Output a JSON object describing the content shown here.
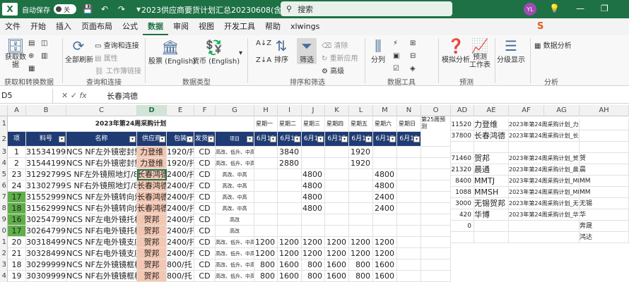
{
  "titlebar": {
    "autosave": "自动保存",
    "toggle": "关",
    "doc_title": "2023供应商要货计划汇总20230608(含...",
    "search_placeholder": "搜索",
    "avatar": "YL"
  },
  "menu": [
    "文件",
    "开始",
    "插入",
    "页面布局",
    "公式",
    "数据",
    "审阅",
    "视图",
    "开发工具",
    "帮助",
    "xlwings"
  ],
  "menu_active": "数据",
  "ribbon": {
    "get_data": "获取数\n据",
    "refresh_all": "全部刷新",
    "query_conn": "查询和连接",
    "properties": "属性",
    "workbook_links": "工作簿链接",
    "stocks": "股票 (English)",
    "currency": "货币 (English)",
    "sort": "排序",
    "filter": "筛选",
    "clear": "清除",
    "reapply": "重新应用",
    "advanced": "高级",
    "split": "分列",
    "whatif": "模拟分析",
    "forecast": "预测\n工作表",
    "outline": "分级显示",
    "data_analysis": "数据分析",
    "groups": {
      "get_transform": "获取和转换数据",
      "query": "查询和连接",
      "data_types": "数据类型",
      "sort_filter": "排序和筛选",
      "data_tools": "数据工具",
      "forecast": "预测",
      "analysis": "分析"
    }
  },
  "formula": {
    "namebox": "D5",
    "value": "长春鸿德"
  },
  "columns": [
    "A",
    "B",
    "C",
    "D",
    "E",
    "F",
    "G",
    "H",
    "I",
    "J",
    "K",
    "L",
    "M",
    "N",
    "O",
    "AD",
    "AE",
    "AF",
    "AG",
    "AH"
  ],
  "selected_column": "D",
  "sheet": {
    "title": "2023年第24周采购计划",
    "day_headers": [
      "星期一",
      "星期二",
      "星期三",
      "星期四",
      "星期五",
      "星期六",
      "星期日"
    ],
    "w25": "第25周预\n测",
    "hdr": [
      "项",
      "料号",
      "名称",
      "供应商",
      "包装",
      "发货地",
      "项目",
      "6月12",
      "6月13",
      "6月14",
      "6月15",
      "6月16",
      "6月17",
      "6月18"
    ],
    "rows": [
      {
        "r": "3",
        "a": "1",
        "b": "315341999",
        "c": "NCS NF左外镜密封垫",
        "d": "力登维",
        "e": "1920/托",
        "f": "CD",
        "g": "高改、低升、中高",
        "vals": [
          "",
          "3840",
          "",
          "",
          "1920",
          "",
          ""
        ],
        "ad": "",
        "ae": "",
        "af": "",
        "ag": "",
        "ah": "",
        "green": false
      },
      {
        "r": "4",
        "a": "2",
        "b": "315441999",
        "c": "NCS NF右外镜密封垫",
        "d": "力登维",
        "e": "1920/托",
        "f": "CD",
        "g": "高改、低升、中高",
        "vals": [
          "",
          "2880",
          "",
          "",
          "1920",
          "",
          ""
        ],
        "ad": "",
        "ae": "",
        "af": "",
        "ag": "",
        "ah": "",
        "green": false
      },
      {
        "r": "5",
        "a": "23",
        "b": "312927999",
        "c": "S NF左外镜照地灯/8202",
        "d": "长春鸿德",
        "e": "2400/托",
        "f": "CD",
        "g": "高改、中高",
        "vals": [
          "",
          "",
          "4800",
          "",
          "",
          "4800",
          ""
        ],
        "ad": "",
        "ae": "",
        "af": "",
        "ag": "",
        "ah": "",
        "green": false
      },
      {
        "r": "6",
        "a": "24",
        "b": "313027999",
        "c": "S NF右外镜照地灯/8202",
        "d": "长春鸿德",
        "e": "2400/托",
        "f": "CD",
        "g": "高改、中高",
        "vals": [
          "",
          "",
          "4800",
          "",
          "",
          "4800",
          ""
        ],
        "ad": "",
        "ae": "",
        "af": "",
        "ag": "",
        "ah": "",
        "green": false
      },
      {
        "r": "7",
        "a": "17",
        "b": "315529999",
        "c": "NCS NF左外镜转向灯",
        "d": "长春鸿德",
        "e": "2400/托",
        "f": "CD",
        "g": "高改、中高",
        "vals": [
          "",
          "",
          "4800",
          "",
          "",
          "2400",
          ""
        ],
        "ad": "",
        "ae": "",
        "af": "",
        "ag": "",
        "ah": "",
        "green": true
      },
      {
        "r": "8",
        "a": "18",
        "b": "315629999",
        "c": "NCS NF右外镜转向灯",
        "d": "长春鸿德",
        "e": "2400/托",
        "f": "CD",
        "g": "高改、中高",
        "vals": [
          "",
          "",
          "4800",
          "",
          "",
          "2400",
          ""
        ],
        "ad": "",
        "ae": "",
        "af": "",
        "ag": "",
        "ah": "",
        "green": true
      },
      {
        "r": "9",
        "a": "16",
        "b": "302547999",
        "c": "NCS NF左电外镜托板",
        "d": "贺邦",
        "e": "2400/托",
        "f": "CD",
        "g": "高改",
        "vals": [
          "",
          "",
          "",
          "",
          "",
          "",
          ""
        ],
        "ad": "",
        "ae": "",
        "af": "",
        "ag": "",
        "ah": "",
        "green": true
      },
      {
        "r": "0",
        "a": "17",
        "b": "302647999",
        "c": "NCS NF右电外镜托板",
        "d": "贺邦",
        "e": "2400/托",
        "f": "CD",
        "g": "高改",
        "vals": [
          "",
          "",
          "",
          "",
          "",
          "",
          ""
        ],
        "ad": "",
        "ae": "",
        "af": "",
        "ag": "",
        "ah": "",
        "green": true
      },
      {
        "r": "1",
        "a": "20",
        "b": "303184999",
        "c": "NCS NF左电外镜支座",
        "d": "贺邦",
        "e": "2400/托",
        "f": "CD",
        "g": "高改、低升、中高",
        "vals": [
          "1200",
          "1200",
          "1200",
          "1200",
          "1200",
          "1200",
          ""
        ],
        "ad": "",
        "ae": "",
        "af": "",
        "ag": "",
        "ah": "",
        "green": false
      },
      {
        "r": "2",
        "a": "21",
        "b": "303284999",
        "c": "NCS NF右电外镜支座",
        "d": "贺邦",
        "e": "2400/托",
        "f": "CD",
        "g": "高改、低升、中高",
        "vals": [
          "1200",
          "1200",
          "1200",
          "1200",
          "1200",
          "1200",
          ""
        ],
        "ad": "",
        "ae": "",
        "af": "",
        "ag": "",
        "ah": "",
        "green": false
      },
      {
        "r": "3",
        "a": "18",
        "b": "302999999",
        "c": "NCS NF左外镜镜框板",
        "d": "贺邦",
        "e": "800/托",
        "f": "CD",
        "g": "高改、低升、中高",
        "vals": [
          "800",
          "1600",
          "800",
          "1600",
          "800",
          "1600",
          ""
        ],
        "ad": "",
        "ae": "",
        "af": "",
        "ag": "",
        "ah": "",
        "green": false
      },
      {
        "r": "4",
        "a": "19",
        "b": "303099999",
        "c": "NCS NF右外镜镜框板",
        "d": "贺邦",
        "e": "800/托",
        "f": "CD",
        "g": "高改、低升、中高",
        "vals": [
          "800",
          "1600",
          "800",
          "1600",
          "800",
          "1600",
          ""
        ],
        "ad": "",
        "ae": "",
        "af": "",
        "ag": "",
        "ah": "",
        "green": false
      },
      {
        "r": "5",
        "a": "15",
        "b": "303726999",
        "c": "NCS NF左外镜护罩",
        "d": "贺邦",
        "e": "720/托",
        "f": "CD",
        "g": "高改、低升、中高",
        "vals": [
          "720",
          "1440",
          "720",
          "1440",
          "720",
          "1440",
          ""
        ],
        "ad": "",
        "ae": "",
        "af": "",
        "ag": "",
        "ah": "",
        "green": false
      }
    ],
    "side": [
      {
        "ad": "11520",
        "ae": "力登维",
        "af": "2023年第24周采购计划_力登维",
        "ag": "",
        "ah": ""
      },
      {
        "ad": "37800",
        "ae": "长春鸿德",
        "af": "2023年第24周采购计划_长春鸿德",
        "ag": "",
        "ah": ""
      },
      {
        "ad": "",
        "ae": "",
        "af": "",
        "ag": "",
        "ah": ""
      },
      {
        "ad": "71460",
        "ae": "贺邦",
        "af": "2023年第24周采购计划_贺邦",
        "ag": "",
        "ah": "贺"
      },
      {
        "ad": "21320",
        "ae": "晨通",
        "af": "2023年第24周采购计划_晨通",
        "ag": "",
        "ah": "晨"
      },
      {
        "ad": "8400",
        "ae": "MMTJ",
        "af": "2023年第24周采购计划_MMTJ",
        "ag": "",
        "ah": "MM"
      },
      {
        "ad": "1088",
        "ae": "MMSH",
        "af": "2023年第24周采购计划_MMSH",
        "ag": "",
        "ah": "MM"
      },
      {
        "ad": "3000",
        "ae": "无锡贺邦",
        "af": "2023年第24周采购计划_无锡贺邦",
        "ag": "",
        "ah": "无锡"
      },
      {
        "ad": "420",
        "ae": "华博",
        "af": "2023年第24周采购计划_华博",
        "ag": "",
        "ah": "华"
      },
      {
        "ad": "0",
        "ae": "",
        "af": "",
        "ag": "",
        "ah": "奔晟"
      },
      {
        "ad": "",
        "ae": "",
        "af": "",
        "ag": "",
        "ah": "鸿达"
      }
    ],
    "row_labels": [
      "1",
      "2"
    ]
  },
  "colors": {
    "excel_green": "#1e7145",
    "header_navy": "#1f3b73",
    "supplier_fill": "#f4c7b3",
    "item_green": "#5fae4a"
  }
}
